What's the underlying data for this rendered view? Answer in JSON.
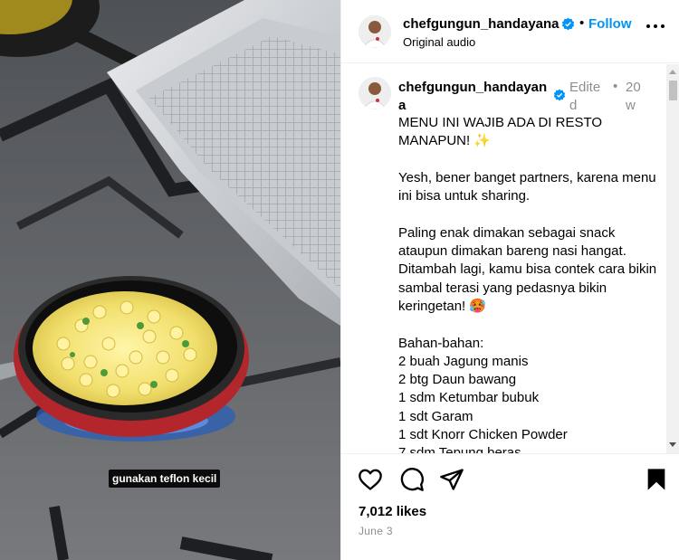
{
  "media": {
    "subtitle": "gunakan teflon kecil"
  },
  "header": {
    "username": "chefgungun_handayana",
    "follow_label": "Follow",
    "separator": "•",
    "audio_label": "Original audio"
  },
  "caption": {
    "username": "chefgungun_handayana",
    "edited_label": "Edited",
    "separator": "•",
    "time_ago": "20w",
    "text": "MENU INI WAJIB ADA DI RESTO MANAPUN! ✨\n\nYesh, bener banget partners, karena menu ini bisa untuk sharing.\n\nPaling enak dimakan sebagai snack ataupun dimakan bareng nasi hangat. Ditambah lagi, kamu bisa contek cara bikin sambal terasi yang pedasnya bikin keringetan! 🥵\n\nBahan-bahan:\n2 buah Jagung manis\n2 btg Daun bawang\n1 sdm Ketumbar bubuk\n1 sdt Garam\n1 sdt Knorr Chicken Powder\n7 sdm Tepung beras"
  },
  "footer": {
    "likes": "7,012 likes",
    "date": "June 3"
  },
  "colors": {
    "accent": "#0095f6",
    "muted": "#8e8e8e",
    "pan_red": "#b3262b"
  },
  "icons": [
    "heart-icon",
    "comment-icon",
    "share-icon",
    "bookmark-icon",
    "more-options-icon",
    "verified-badge-icon"
  ]
}
